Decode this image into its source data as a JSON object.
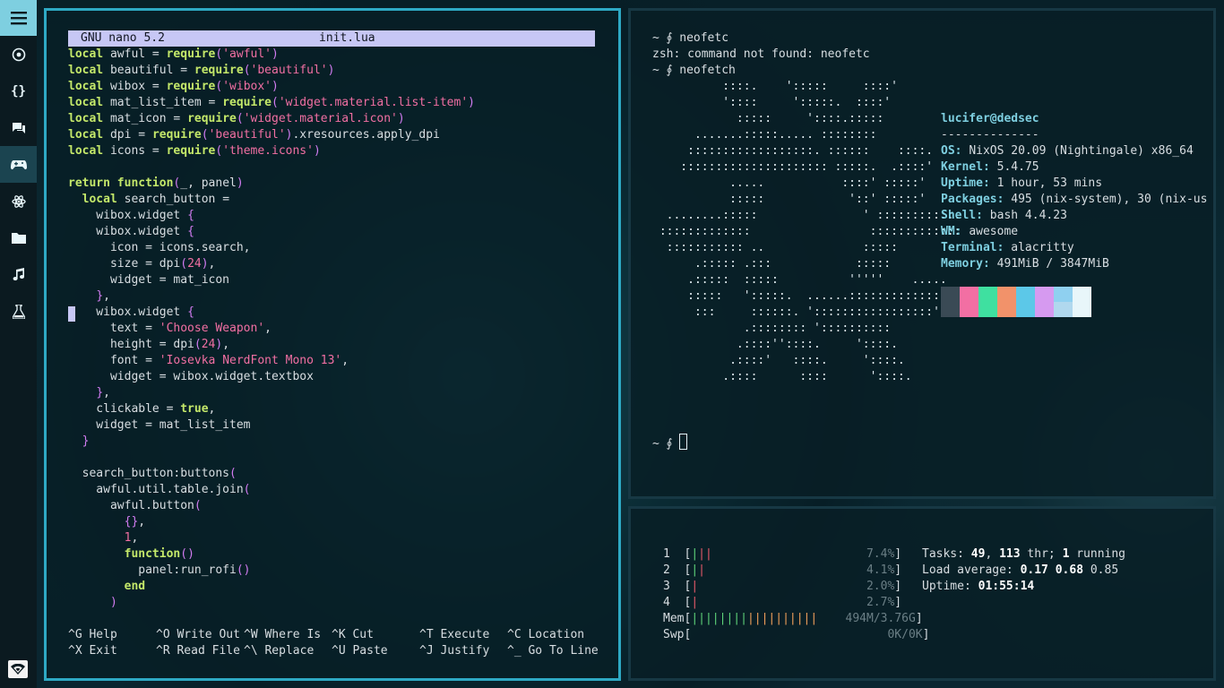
{
  "sidebar": {
    "menu_icon": "hamburger-icon",
    "items": [
      {
        "name": "chrome-icon",
        "glyph": "◎"
      },
      {
        "name": "code-braces-icon",
        "glyph": "{}"
      },
      {
        "name": "chat-icon",
        "glyph": "▰"
      },
      {
        "name": "gamepad-icon",
        "glyph": "⊶",
        "active": true
      },
      {
        "name": "atom-icon",
        "glyph": "✲"
      },
      {
        "name": "folder-icon",
        "glyph": "▬"
      },
      {
        "name": "music-note-icon",
        "glyph": "♫"
      },
      {
        "name": "flask-icon",
        "glyph": "⚗"
      }
    ],
    "bottom_icon": "wifi-icon"
  },
  "nano": {
    "version": "GNU nano 5.2",
    "filename": "init.lua",
    "help": [
      {
        "key": "^G",
        "label": "Help"
      },
      {
        "key": "^O",
        "label": "Write Out"
      },
      {
        "key": "^W",
        "label": "Where Is"
      },
      {
        "key": "^K",
        "label": "Cut"
      },
      {
        "key": "^T",
        "label": "Execute"
      },
      {
        "key": "^C",
        "label": "Location"
      },
      {
        "key": "^X",
        "label": "Exit"
      },
      {
        "key": "^R",
        "label": "Read File"
      },
      {
        "key": "^\\",
        "label": "Replace"
      },
      {
        "key": "^U",
        "label": "Paste"
      },
      {
        "key": "^J",
        "label": "Justify"
      },
      {
        "key": "^_",
        "label": "Go To Line"
      }
    ]
  },
  "neofetch": {
    "cmd1": "~ ∮ neofetc",
    "error": "zsh: command not found: neofetc",
    "cmd2": "~ ∮ neofetch",
    "prompt": "~ ∮ ",
    "user_host": "lucifer@dedsec",
    "separator": "--------------",
    "info": [
      {
        "label": "OS",
        "value": "NixOS 20.09 (Nightingale) x86_64"
      },
      {
        "label": "Kernel",
        "value": "5.4.75"
      },
      {
        "label": "Uptime",
        "value": "1 hour, 53 mins"
      },
      {
        "label": "Packages",
        "value": "495 (nix-system), 30 (nix-us"
      },
      {
        "label": "Shell",
        "value": "bash 4.4.23"
      },
      {
        "label": "WM",
        "value": "awesome"
      },
      {
        "label": "Terminal",
        "value": "alacritty"
      },
      {
        "label": "Memory",
        "value": "491MiB / 3847MiB"
      }
    ],
    "palette_top": [
      "#3a4a55",
      "#f26fa3",
      "#3fe0a0",
      "#f2926a",
      "#5cc8e8",
      "#d69af0",
      "#8fd0f0",
      "#e8f6fa"
    ],
    "palette_bottom": [
      "#3a4a55",
      "#f26fa3",
      "#3fe0a0",
      "#f2926a",
      "#5cc8e8",
      "#d69af0",
      "#b0d8ee",
      "#e8f6fa"
    ]
  },
  "htop": {
    "cpus": [
      {
        "n": "1",
        "pct": "7.4%"
      },
      {
        "n": "2",
        "pct": "4.1%"
      },
      {
        "n": "3",
        "pct": "2.0%"
      },
      {
        "n": "4",
        "pct": "2.7%"
      }
    ],
    "mem_label": "Mem",
    "mem_value": "494M/3.76G",
    "swp_label": "Swp",
    "swp_value": "0K/0K",
    "tasks_label": "Tasks: ",
    "tasks": "49",
    "threads": "113",
    "running": "1",
    "load_label": "Load average: ",
    "load1": "0.17",
    "load5": "0.68",
    "load15": "0.85",
    "uptime_label": "Uptime: ",
    "uptime": "01:55:14"
  }
}
